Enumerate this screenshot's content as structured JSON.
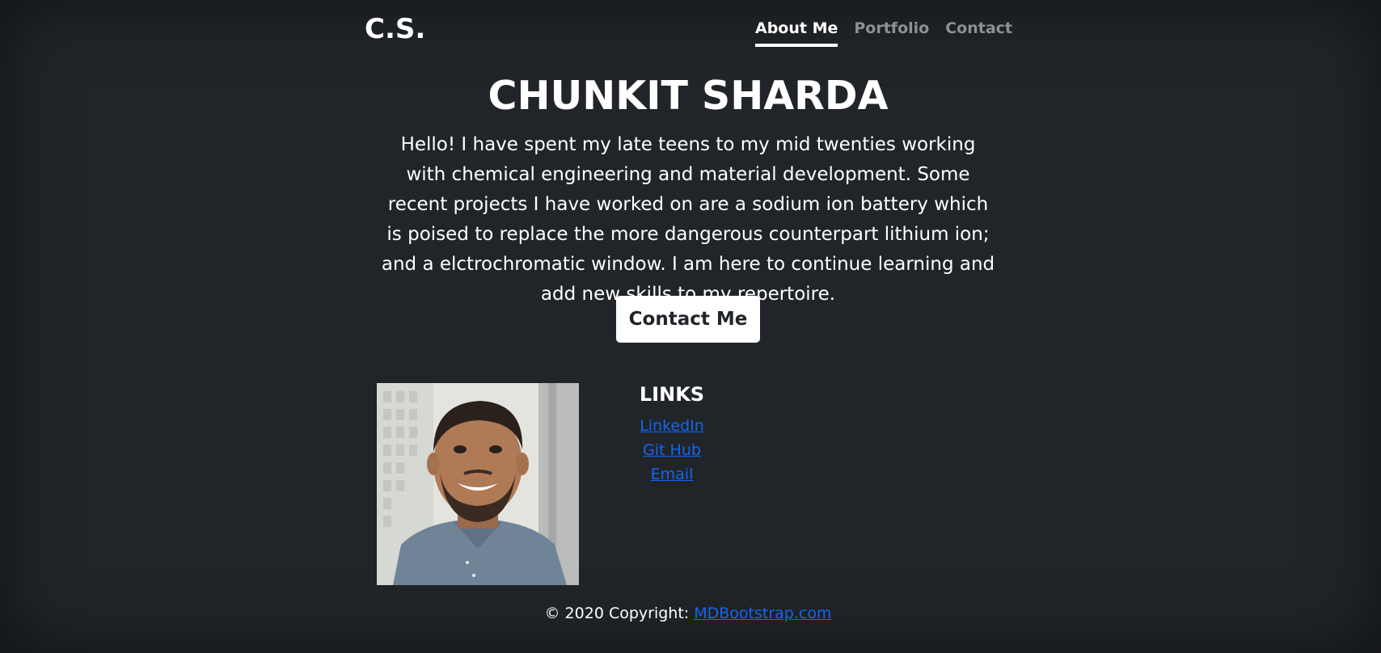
{
  "header": {
    "brand": "C.S.",
    "nav": [
      {
        "label": "About Me",
        "active": true
      },
      {
        "label": "Portfolio",
        "active": false
      },
      {
        "label": "Contact",
        "active": false
      }
    ]
  },
  "hero": {
    "title": "CHUNKIT SHARDA",
    "intro": "Hello! I have spent my late teens to my mid twenties working with chemical engineering and material development. Some recent projects I have worked on are a sodium ion battery which is poised to replace the more dangerous counterpart lithium ion; and a elctrochromatic window. I am here to continue learning and add new skills to my repertoire.",
    "button_label": "Contact Me"
  },
  "profile": {
    "photo_icon": "portrait-photo"
  },
  "links": {
    "title": "LINKS",
    "items": [
      "LinkedIn",
      "Git Hub",
      "Email"
    ]
  },
  "footer": {
    "copyright": "© 2020 Copyright: ",
    "link_label": "MDBootstrap.com"
  },
  "colors": {
    "background": "#212529",
    "link": "#1266f1",
    "text": "#ffffff"
  }
}
